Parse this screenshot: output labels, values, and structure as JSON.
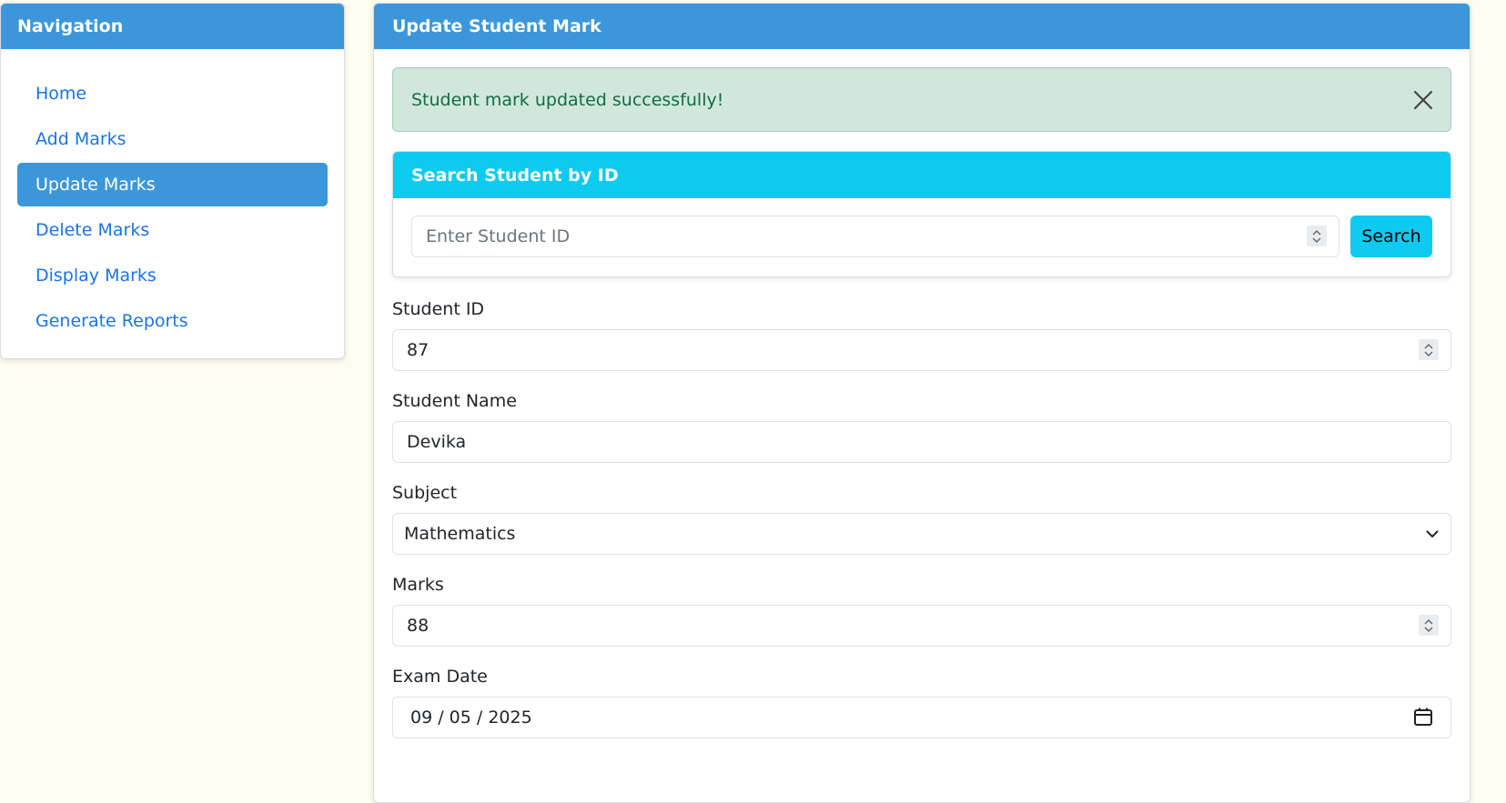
{
  "sidebar": {
    "title": "Navigation",
    "items": [
      {
        "label": "Home",
        "active": false
      },
      {
        "label": "Add Marks",
        "active": false
      },
      {
        "label": "Update Marks",
        "active": true
      },
      {
        "label": "Delete Marks",
        "active": false
      },
      {
        "label": "Display Marks",
        "active": false
      },
      {
        "label": "Generate Reports",
        "active": false
      }
    ]
  },
  "main": {
    "title": "Update Student Mark",
    "alert": {
      "message": "Student mark updated successfully!"
    },
    "search": {
      "title": "Search Student by ID",
      "placeholder": "Enter Student ID",
      "button_label": "Search"
    },
    "form": {
      "student_id": {
        "label": "Student ID",
        "value": "87"
      },
      "student_name": {
        "label": "Student Name",
        "value": "Devika"
      },
      "subject": {
        "label": "Subject",
        "value": "Mathematics"
      },
      "marks": {
        "label": "Marks",
        "value": "88"
      },
      "exam_date": {
        "label": "Exam Date",
        "value": "09 / 05 / 2025"
      }
    }
  },
  "colors": {
    "primary": "#3b97da",
    "info": "#0dcaf0",
    "success_bg": "#d1e7dd",
    "success_text": "#146c43",
    "link": "#1a73e8",
    "page_bg": "#fefef0"
  }
}
